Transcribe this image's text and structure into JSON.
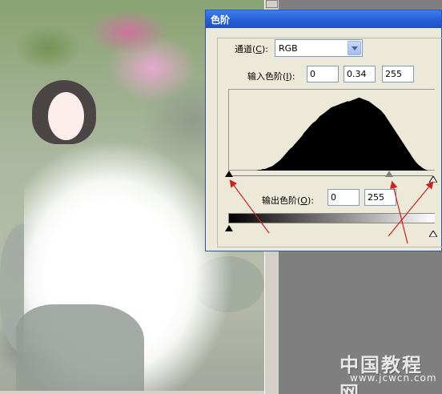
{
  "dialog": {
    "title": "色阶",
    "channel_label": "通道(",
    "channel_key": "C",
    "channel_label_end": "):",
    "channel_value": "RGB",
    "input_levels_label": "输入色阶(",
    "input_levels_key": "I",
    "input_levels_label_end": "):",
    "input_black": "0",
    "input_gamma": "0.34",
    "input_white": "255",
    "output_levels_label": "输出色阶(",
    "output_levels_key": "O",
    "output_levels_label_end": "):",
    "output_black": "0",
    "output_white": "255"
  },
  "histogram": {
    "levels": [
      0,
      0,
      0,
      0,
      0,
      0,
      0,
      0,
      0,
      0,
      0,
      0,
      0,
      0,
      0,
      1,
      1,
      2,
      2,
      3,
      4,
      5,
      6,
      8,
      10,
      12,
      14,
      17,
      20,
      23,
      26,
      29,
      31,
      34,
      37,
      40,
      43,
      46,
      50,
      53,
      56,
      59,
      62,
      64,
      66,
      69,
      72,
      74,
      76,
      78,
      80,
      82,
      84,
      85,
      86,
      87,
      88,
      89,
      90,
      91,
      92,
      92,
      93,
      94,
      95,
      96,
      97,
      96,
      95,
      94,
      93,
      92,
      90,
      88,
      86,
      84,
      82,
      80,
      77,
      74,
      70,
      66,
      62,
      58,
      54,
      50,
      46,
      42,
      38,
      34,
      30,
      26,
      22,
      18,
      14,
      11,
      8,
      6,
      4,
      2,
      1,
      0,
      0,
      0,
      0
    ]
  },
  "colors": {
    "titlebar": "#2a62da",
    "dialog_bg": "#ece9d8",
    "annotation_arrow": "#cc2222"
  },
  "watermark": {
    "site_name": "中国教程网",
    "url": "www.jcwcn.com"
  }
}
